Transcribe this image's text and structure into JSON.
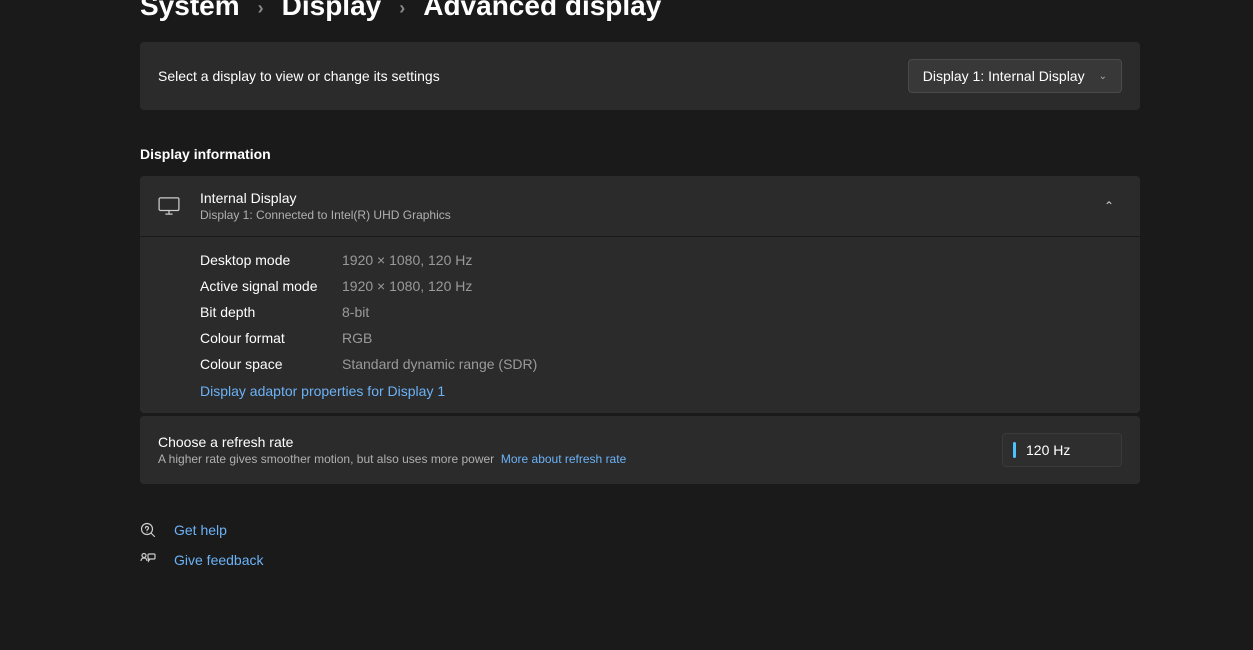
{
  "breadcrumb": {
    "system": "System",
    "display": "Display",
    "advanced": "Advanced display"
  },
  "selector": {
    "label": "Select a display to view or change its settings",
    "value": "Display 1: Internal Display"
  },
  "section": {
    "title": "Display information"
  },
  "info": {
    "title": "Internal Display",
    "subtitle": "Display 1: Connected to Intel(R) UHD Graphics",
    "rows": {
      "desktop_mode_k": "Desktop mode",
      "desktop_mode_v": "1920 × 1080, 120 Hz",
      "active_signal_k": "Active signal mode",
      "active_signal_v": "1920 × 1080, 120 Hz",
      "bit_depth_k": "Bit depth",
      "bit_depth_v": "8-bit",
      "colour_format_k": "Colour format",
      "colour_format_v": "RGB",
      "colour_space_k": "Colour space",
      "colour_space_v": "Standard dynamic range (SDR)"
    },
    "adapter_link": "Display adaptor properties for Display 1"
  },
  "refresh": {
    "title": "Choose a refresh rate",
    "subtitle": "A higher rate gives smoother motion, but also uses more power",
    "more_link": "More about refresh rate",
    "value": "120 Hz"
  },
  "footer": {
    "help": "Get help",
    "feedback": "Give feedback"
  }
}
